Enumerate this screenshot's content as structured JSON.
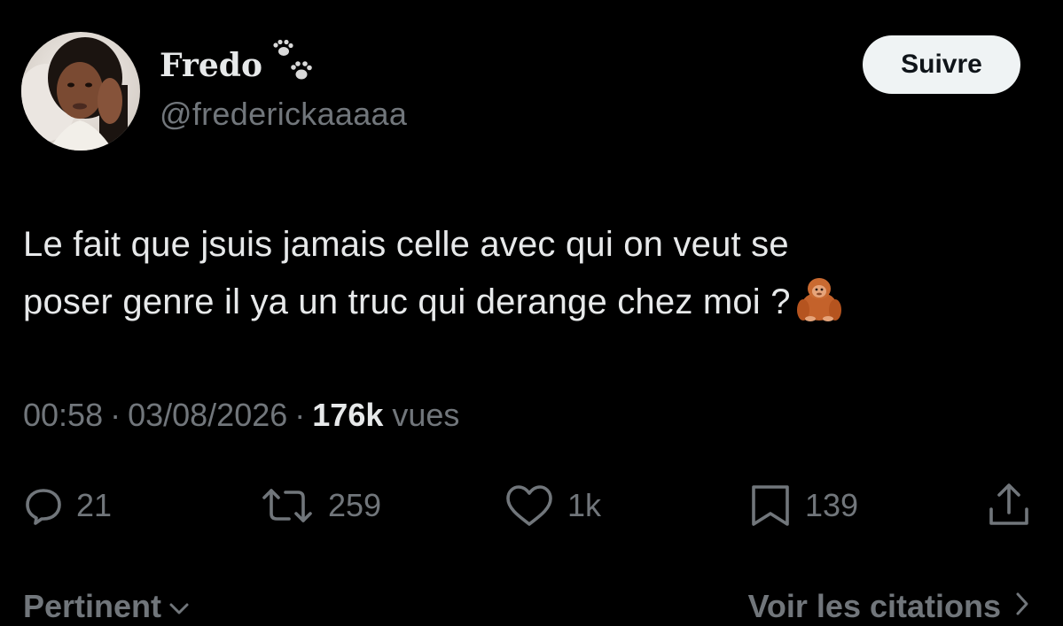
{
  "author": {
    "display_name": "Fredo",
    "handle": "@frederickaaaaa",
    "name_emoji": "paw-prints-icon",
    "avatar": "avatar-photo"
  },
  "follow_label": "Suivre",
  "tweet": {
    "text_line1": "Le fait que jsuis jamais celle avec qui on veut se",
    "text_line2": "poser genre il ya un truc qui derange chez moi ?",
    "emoji": "orangutan-icon"
  },
  "meta": {
    "time": "00:58",
    "separator": "·",
    "date": "03/08/2026",
    "views_count": "176k",
    "views_label": "vues"
  },
  "actions": {
    "replies": "21",
    "reposts": "259",
    "likes": "1k",
    "bookmarks": "139"
  },
  "footer": {
    "sort_label": "Pertinent",
    "quotes_label": "Voir les citations"
  },
  "colors": {
    "background": "#000000",
    "primary_text": "#e7e9ea",
    "secondary_text": "#71767b",
    "button_bg": "#eff3f4",
    "button_text": "#0f1419"
  }
}
